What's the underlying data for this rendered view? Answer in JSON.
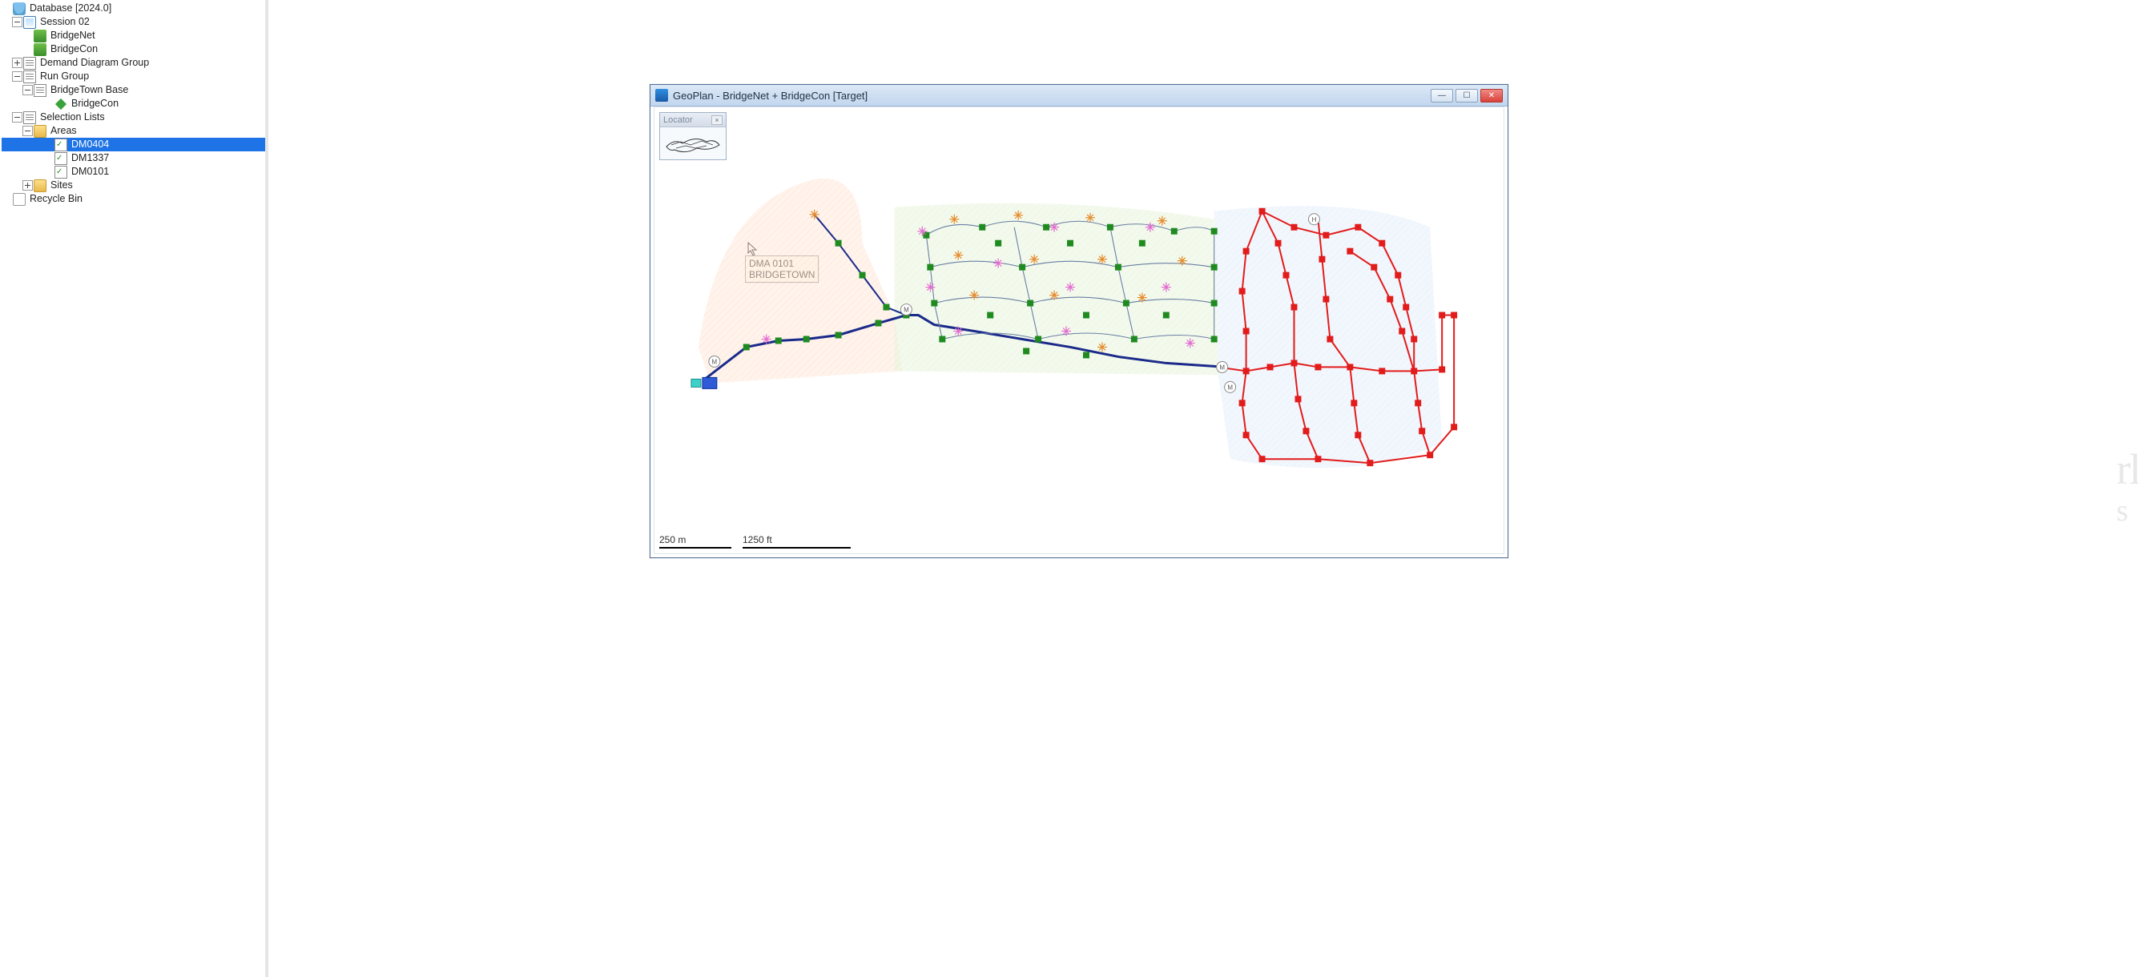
{
  "tree": {
    "root": {
      "label": "Database [2024.0]"
    },
    "session": {
      "label": "Session 02"
    },
    "bridgenet": {
      "label": "BridgeNet"
    },
    "bridgecon": {
      "label": "BridgeCon"
    },
    "demand_group": {
      "label": "Demand Diagram Group"
    },
    "run_group": {
      "label": "Run Group"
    },
    "bridgetown_base": {
      "label": "BridgeTown Base"
    },
    "bridgecon2": {
      "label": "BridgeCon"
    },
    "selection_lists": {
      "label": "Selection Lists"
    },
    "areas": {
      "label": "Areas"
    },
    "dm0404": {
      "label": "DM0404"
    },
    "dm1337": {
      "label": "DM1337"
    },
    "dm0101": {
      "label": "DM0101"
    },
    "sites": {
      "label": "Sites"
    },
    "recycle": {
      "label": "Recycle Bin"
    }
  },
  "map_window": {
    "title": "GeoPlan - BridgeNet + BridgeCon [Target]"
  },
  "locator": {
    "title": "Locator"
  },
  "tooltip": {
    "line1": "DMA 0101",
    "line2": "BRIDGETOWN"
  },
  "scalebar": {
    "metric": "250 m",
    "imperial": "1250 ft"
  },
  "colors": {
    "zone_peach": "#ffe9db",
    "zone_green": "#e9f6df",
    "zone_blue": "#e7f1fb",
    "net_main": "#1b2a8a",
    "net_green": "#1f8a1f",
    "net_red": "#e21b1b",
    "marker_orange": "#e58a2a",
    "marker_pink": "#e36bd0"
  }
}
